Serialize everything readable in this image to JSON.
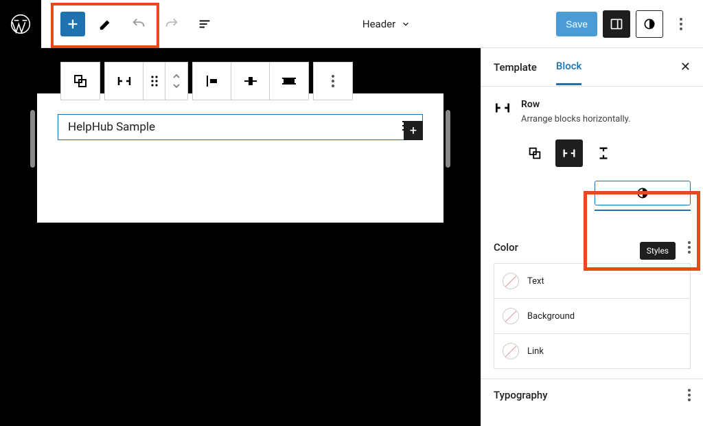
{
  "toolbar": {
    "center_title": "Header",
    "save_label": "Save"
  },
  "canvas": {
    "row_text": "HelpHub Sample"
  },
  "sidebar": {
    "tabs": {
      "template": "Template",
      "block": "Block"
    },
    "block_title": "Row",
    "block_desc": "Arrange blocks horizontally.",
    "tooltip": "Styles",
    "panels": {
      "color": "Color",
      "typography": "Typography",
      "color_items": {
        "text": "Text",
        "background": "Background",
        "link": "Link"
      }
    }
  }
}
